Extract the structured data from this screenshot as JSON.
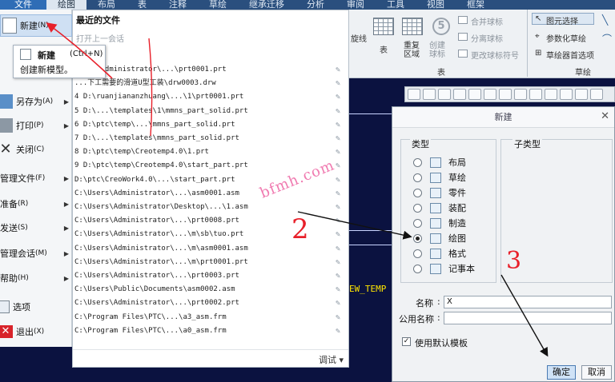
{
  "menubar": {
    "tabs": [
      "文件",
      "绘图",
      "布局",
      "表",
      "注释",
      "草绘",
      "继承迁移",
      "分析",
      "审阅",
      "工具",
      "视图",
      "框架"
    ],
    "active_index": 1
  },
  "ribbon": {
    "line_label": "旋线",
    "table_label": "表",
    "regen_label": "重复区域",
    "create_balloon": "创建球标",
    "merge_balloon": "合并球标",
    "split_balloon": "分离球标",
    "change_balloon": "更改球标符号",
    "group_table": "表",
    "elem_select": "图元选择",
    "param_sketch": "参数化草绘",
    "sketcher_pref": "草绘器首选项",
    "group_sketch": "草绘"
  },
  "canvas": {
    "text": "EW_TEMP"
  },
  "file_menu": {
    "items": [
      {
        "label": "新建",
        "key": "(N)"
      },
      {
        "label": "另存为",
        "key": "(A)"
      },
      {
        "label": "打印",
        "key": "(P)"
      },
      {
        "label": "关闭",
        "key": "(C)"
      },
      {
        "label": "管理文件",
        "key": "(F)"
      },
      {
        "label": "准备",
        "key": "(R)"
      },
      {
        "label": "发送",
        "key": "(S)"
      },
      {
        "label": "管理会话",
        "key": "(M)"
      },
      {
        "label": "帮助",
        "key": "(H)"
      },
      {
        "label": "选项",
        "key": ""
      },
      {
        "label": "退出",
        "key": "(X)"
      }
    ]
  },
  "new_submenu": {
    "title": "新建",
    "shortcut": "(Ctrl+N)",
    "description": "创建新模型。"
  },
  "recent": {
    "title": "最近的文件",
    "open_last": "打开上一会话",
    "rows": [
      "...rs\\Administrator\\...\\prt0001.prt",
      "...下工需要的滑道U型工装\\drw0003.drw",
      "4 D:\\ruanjiananzhuang\\...\\1\\prt0001.prt",
      "5 D:\\...\\templates\\1\\mmns_part_solid.prt",
      "6 D:\\ptc\\temp\\...\\mmns_part_solid.prt",
      "7 D:\\...\\templates\\mmns_part_solid.prt",
      "8 D:\\ptc\\temp\\Creotemp4.0\\1.prt",
      "9 D:\\ptc\\temp\\Creotemp4.0\\start_part.prt",
      "D:\\ptc\\CreoWork4.0\\...\\start_part.prt",
      "C:\\Users\\Administrator\\...\\asm0001.asm",
      "C:\\Users\\Administrator\\Desktop\\...\\1.asm",
      "C:\\Users\\Administrator\\...\\prt0008.prt",
      "C:\\Users\\Administrator\\...\\m\\sb\\tuo.prt",
      "C:\\Users\\Administrator\\...\\m\\asm0001.asm",
      "C:\\Users\\Administrator\\...\\m\\prt0001.prt",
      "C:\\Users\\Administrator\\...\\prt0003.prt",
      "C:\\Users\\Public\\Documents\\asm0002.asm",
      "C:\\Users\\Administrator\\...\\prt0002.prt",
      "C:\\Program Files\\PTC\\...\\a3_asm.frm",
      "C:\\Program Files\\PTC\\...\\a0_asm.frm"
    ],
    "footer": "调试 ▾"
  },
  "dialog": {
    "title": "新建",
    "type_label": "类型",
    "subtype_label": "子类型",
    "types": [
      {
        "label": "布局",
        "selected": false
      },
      {
        "label": "草绘",
        "selected": false
      },
      {
        "label": "零件",
        "selected": false
      },
      {
        "label": "装配",
        "selected": false
      },
      {
        "label": "制造",
        "selected": false
      },
      {
        "label": "绘图",
        "selected": true
      },
      {
        "label": "格式",
        "selected": false
      },
      {
        "label": "记事本",
        "selected": false
      }
    ],
    "name_label": "名称",
    "name_value": "X",
    "common_name_label": "公用名称",
    "common_name_value": "",
    "use_default_template": "使用默认模板",
    "use_default_checked": true,
    "ok": "确定",
    "cancel": "取消"
  },
  "annotations": {
    "watermark": "bfmh.com",
    "step2": "2",
    "step3": "3",
    "annotation_color": "#e8202a"
  },
  "colors": {
    "canvas_bg": "#0b1240",
    "menubar_bg": "#2a4f7e",
    "canvas_text": "#ffe600"
  }
}
